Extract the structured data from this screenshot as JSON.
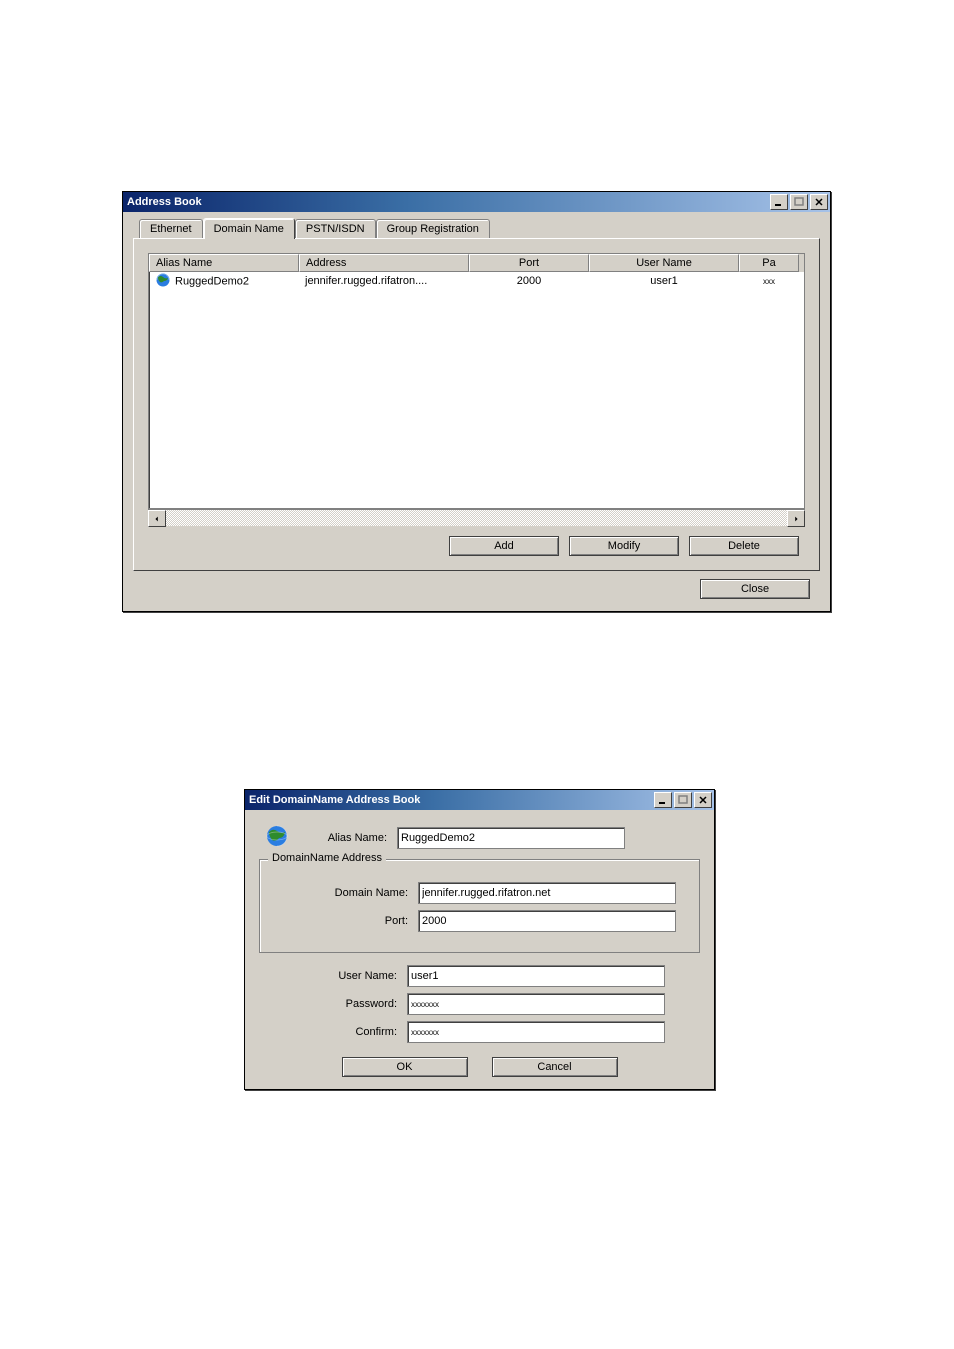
{
  "window1": {
    "title": "Address Book",
    "tabs": {
      "ethernet": "Ethernet",
      "domain_name": "Domain Name",
      "pstn_isdn": "PSTN/ISDN",
      "group_reg": "Group Registration"
    },
    "columns": {
      "alias": "Alias Name",
      "address": "Address",
      "port": "Port",
      "user": "User Name",
      "pass": "Pa"
    },
    "row": {
      "alias": "RuggedDemo2",
      "address": "jennifer.rugged.rifatron....",
      "port": "2000",
      "user": "user1",
      "pass": "xxx"
    },
    "buttons": {
      "add": "Add",
      "modify": "Modify",
      "delete": "Delete",
      "close": "Close"
    }
  },
  "window2": {
    "title": "Edit DomainName Address Book",
    "labels": {
      "alias": "Alias Name:",
      "group": "DomainName Address",
      "domain": "Domain Name:",
      "port": "Port:",
      "user": "User Name:",
      "password": "Password:",
      "confirm": "Confirm:"
    },
    "values": {
      "alias": "RuggedDemo2",
      "domain": "jennifer.rugged.rifatron.net",
      "port": "2000",
      "user": "user1",
      "password": "xxxxxxx",
      "confirm": "xxxxxxx"
    },
    "buttons": {
      "ok": "OK",
      "cancel": "Cancel"
    }
  }
}
